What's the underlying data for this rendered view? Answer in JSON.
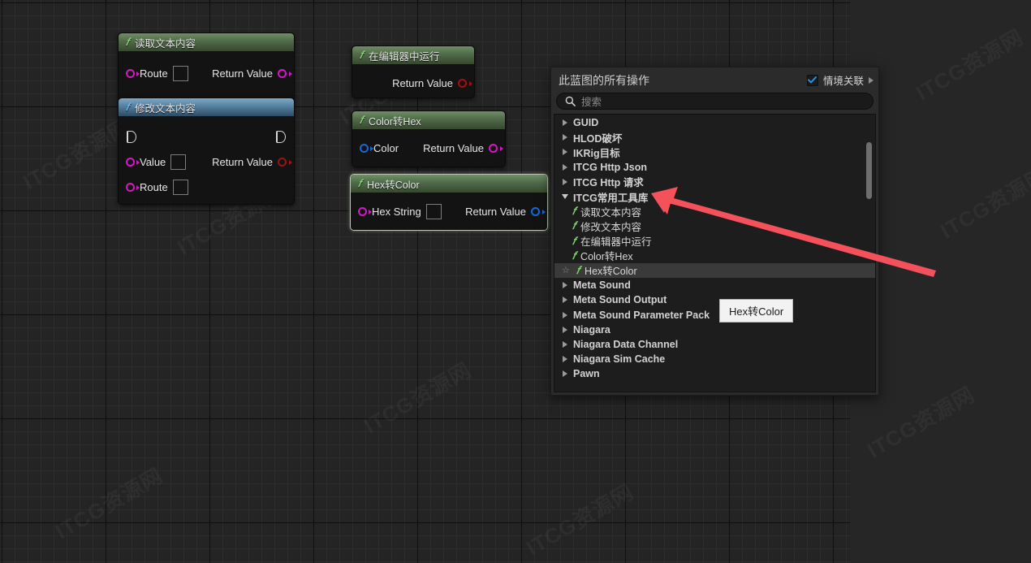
{
  "app": {
    "name": "unreal-blueprint-graph",
    "accent_red": "#f4515b",
    "pin_magenta": "#d218c4",
    "pin_blue": "#1569d6",
    "pin_red": "#a31010",
    "watermark": "ITCG资源网"
  },
  "graph": {
    "nodes": [
      {
        "title": "读取文本内容",
        "title_color": "green",
        "has_exec": false,
        "inputs": [
          {
            "label": "Route",
            "pin": "magenta",
            "has_value_box": true
          }
        ],
        "outputs": [
          {
            "label": "Return Value",
            "pin": "magenta"
          }
        ],
        "selected": false
      },
      {
        "title": "修改文本内容",
        "title_color": "blue",
        "has_exec": true,
        "inputs": [
          {
            "label": "Value",
            "pin": "magenta",
            "has_value_box": true
          },
          {
            "label": "Route",
            "pin": "magenta",
            "has_value_box": true
          }
        ],
        "outputs": [
          {
            "label": "Return Value",
            "pin": "red"
          }
        ],
        "selected": false
      },
      {
        "title": "在编辑器中运行",
        "title_color": "green",
        "has_exec": false,
        "inputs": [],
        "outputs": [
          {
            "label": "Return Value",
            "pin": "red"
          }
        ],
        "selected": false
      },
      {
        "title": "Color转Hex",
        "title_color": "green",
        "has_exec": false,
        "inputs": [
          {
            "label": "Color",
            "pin": "blue",
            "has_value_box": false
          }
        ],
        "outputs": [
          {
            "label": "Return Value",
            "pin": "magenta"
          }
        ],
        "selected": false
      },
      {
        "title": "Hex转Color",
        "title_color": "green",
        "has_exec": false,
        "inputs": [
          {
            "label": "Hex String",
            "pin": "magenta",
            "has_value_box": true
          }
        ],
        "outputs": [
          {
            "label": "Return Value",
            "pin": "blue"
          }
        ],
        "selected": true
      }
    ]
  },
  "context_menu": {
    "title": "此蓝图的所有操作",
    "context_checkbox_label": "情境关联",
    "context_checkbox_checked": true,
    "search_placeholder": "搜索",
    "search_value": "",
    "tree": [
      {
        "label": "GUID",
        "type": "category",
        "expanded": false
      },
      {
        "label": "HLOD破坏",
        "type": "category",
        "expanded": false
      },
      {
        "label": "IKRig目标",
        "type": "category",
        "expanded": false
      },
      {
        "label": "ITCG Http Json",
        "type": "category",
        "expanded": false
      },
      {
        "label": "ITCG Http 请求",
        "type": "category",
        "expanded": false
      },
      {
        "label": "ITCG常用工具库",
        "type": "category",
        "expanded": true
      },
      {
        "label": "读取文本内容",
        "type": "function",
        "highlighted": false,
        "starred": false
      },
      {
        "label": "修改文本内容",
        "type": "function",
        "highlighted": false,
        "starred": false
      },
      {
        "label": "在编辑器中运行",
        "type": "function",
        "highlighted": false,
        "starred": false
      },
      {
        "label": "Color转Hex",
        "type": "function",
        "highlighted": false,
        "starred": false
      },
      {
        "label": "Hex转Color",
        "type": "function",
        "highlighted": true,
        "starred": true
      },
      {
        "label": "Meta Sound",
        "type": "category",
        "expanded": false
      },
      {
        "label": "Meta Sound Output",
        "type": "category",
        "expanded": false
      },
      {
        "label": "Meta Sound Parameter Pack",
        "type": "category",
        "expanded": false
      },
      {
        "label": "Niagara",
        "type": "category",
        "expanded": false
      },
      {
        "label": "Niagara Data Channel",
        "type": "category",
        "expanded": false
      },
      {
        "label": "Niagara Sim Cache",
        "type": "category",
        "expanded": false
      },
      {
        "label": "Pawn",
        "type": "category",
        "expanded": false
      }
    ]
  },
  "tooltip": {
    "text": "Hex转Color"
  }
}
